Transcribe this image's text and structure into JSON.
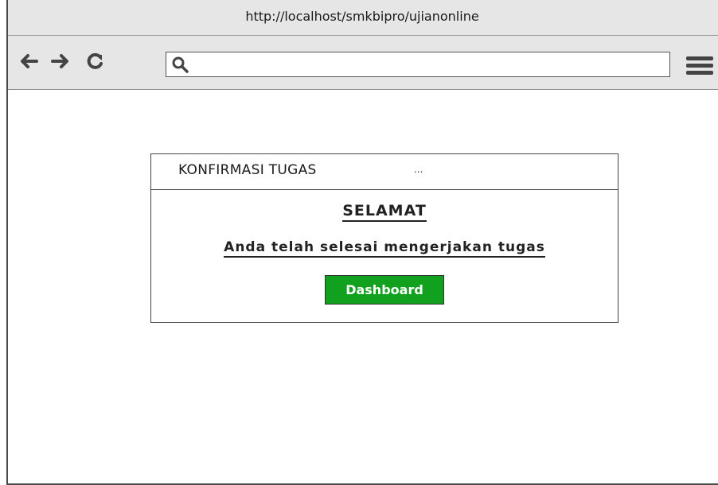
{
  "browser": {
    "url_title": "http://localhost/smkbipro/ujianonline",
    "address_value": "",
    "address_placeholder": "",
    "nav": {
      "back_icon": "arrow-left-icon",
      "forward_icon": "arrow-right-icon",
      "reload_icon": "reload-icon",
      "search_icon": "search-icon",
      "menu_icon": "hamburger-menu-icon"
    }
  },
  "dialog": {
    "title": "KONFIRMASI TUGAS",
    "title_extra": "...",
    "heading": "SELAMAT",
    "message": "Anda telah selesai mengerjakan tugas",
    "button_label": "Dashboard",
    "button_color": "#12a01f"
  }
}
